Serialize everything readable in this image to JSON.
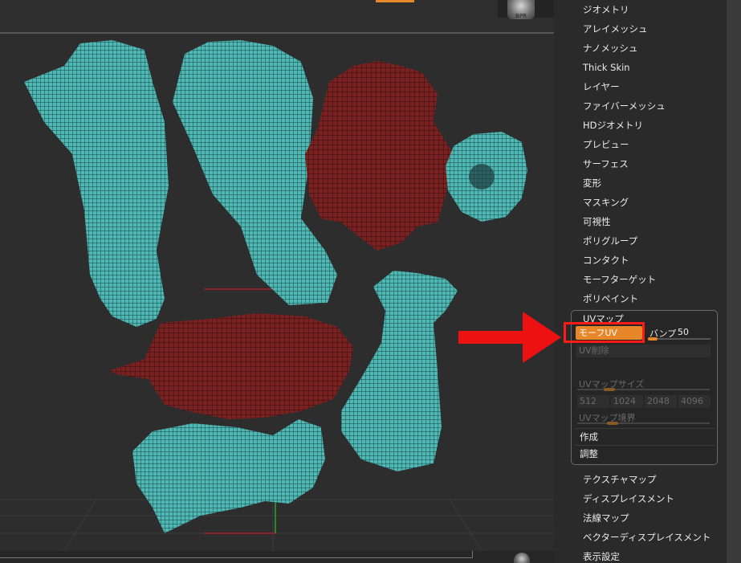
{
  "top": {
    "bpr_label": "BPR"
  },
  "menu": [
    {
      "label": "ジオメトリ",
      "name": "menu-geometry"
    },
    {
      "label": "アレイメッシュ",
      "name": "menu-array-mesh"
    },
    {
      "label": "ナノメッシュ",
      "name": "menu-nano-mesh"
    },
    {
      "label": "Thick Skin",
      "name": "menu-thick-skin"
    },
    {
      "label": "レイヤー",
      "name": "menu-layers"
    },
    {
      "label": "ファイバーメッシュ",
      "name": "menu-fibermesh"
    },
    {
      "label": "HDジオメトリ",
      "name": "menu-hd-geometry"
    },
    {
      "label": "プレビュー",
      "name": "menu-preview"
    },
    {
      "label": "サーフェス",
      "name": "menu-surface"
    },
    {
      "label": "変形",
      "name": "menu-deformation"
    },
    {
      "label": "マスキング",
      "name": "menu-masking"
    },
    {
      "label": "可視性",
      "name": "menu-visibility"
    },
    {
      "label": "ポリグループ",
      "name": "menu-polygroups"
    },
    {
      "label": "コンタクト",
      "name": "menu-contact"
    },
    {
      "label": "モーフターゲット",
      "name": "menu-morph-target"
    },
    {
      "label": "ポリペイント",
      "name": "menu-polypaint"
    }
  ],
  "uv_map": {
    "title": "UVマップ",
    "morph_uv": "モーフUV",
    "bump_label": "バンプ",
    "bump_value": "50",
    "bump_level": 0.1,
    "uv_delete": "UV削除",
    "uv_map_size": "UVマップサイズ",
    "sizes": [
      "512",
      "1024",
      "2048",
      "4096"
    ],
    "uv_map_border": "UVマップ境界",
    "create": "作成",
    "adjust": "調整"
  },
  "menu_after": [
    {
      "label": "テクスチャマップ",
      "name": "menu-texture-map"
    },
    {
      "label": "ディスプレイスメント",
      "name": "menu-displacement"
    },
    {
      "label": "法線マップ",
      "name": "menu-normal-map"
    },
    {
      "label": "ベクターディスプレイスメント",
      "name": "menu-vector-displacement"
    },
    {
      "label": "表示設定",
      "name": "menu-display-properties"
    }
  ],
  "colors": {
    "accent": "#e8862a",
    "highlight": "#ff1a1a",
    "mesh_teal": "#4fb8b4",
    "mesh_red": "#7a2222"
  }
}
